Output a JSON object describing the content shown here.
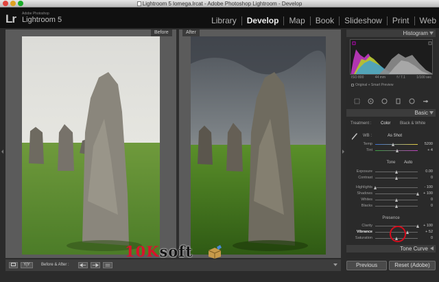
{
  "window": {
    "title": "Lightroom 5 lomega.lrcat - Adobe Photoshop Lightroom - Develop"
  },
  "identity": {
    "mark": "Lr",
    "adobe": "Adobe Photoshop",
    "product": "Lightroom 5"
  },
  "modules": [
    {
      "label": "Library",
      "active": false
    },
    {
      "label": "Develop",
      "active": true
    },
    {
      "label": "Map",
      "active": false
    },
    {
      "label": "Book",
      "active": false
    },
    {
      "label": "Slideshow",
      "active": false
    },
    {
      "label": "Print",
      "active": false
    },
    {
      "label": "Web",
      "active": false
    }
  ],
  "view": {
    "before_label": "Before",
    "after_label": "After"
  },
  "histogram": {
    "title": "Histogram",
    "iso": "ISO 800",
    "focal": "44 mm",
    "aperture": "f / 7.1",
    "shutter": "1/100 sec",
    "preview": "Original + Smart Preview"
  },
  "basic": {
    "title": "Basic",
    "treatment_label": "Treatment :",
    "treatment_color": "Color",
    "treatment_bw": "Black & White",
    "wb_label": "WB :",
    "wb_value": "As Shot",
    "temp": {
      "label": "Temp",
      "value": "5200",
      "pos": 0.43
    },
    "tint": {
      "label": "Tint",
      "value": "+ 4",
      "pos": 0.52
    },
    "tone_label": "Tone",
    "auto_label": "Auto",
    "exposure": {
      "label": "Exposure",
      "value": "0.00",
      "pos": 0.5
    },
    "contrast": {
      "label": "Contrast",
      "value": "0",
      "pos": 0.5
    },
    "highlights": {
      "label": "Highlights",
      "value": "- 100",
      "pos": 0.0
    },
    "shadows": {
      "label": "Shadows",
      "value": "+ 100",
      "pos": 1.0
    },
    "whites": {
      "label": "Whites",
      "value": "0",
      "pos": 0.5
    },
    "blacks": {
      "label": "Blacks",
      "value": "0",
      "pos": 0.5
    },
    "presence_label": "Presence",
    "clarity": {
      "label": "Clarity",
      "value": "+ 100",
      "pos": 1.0
    },
    "vibrance": {
      "label": "Vibrance",
      "value": "+ 52",
      "pos": 0.76
    },
    "saturation": {
      "label": "Saturation",
      "value": "0",
      "pos": 0.5
    }
  },
  "tone_curve": {
    "title": "Tone Curve"
  },
  "toolbar": {
    "before_after_label": "Before & After :",
    "view_btn_a": "",
    "view_btn_b": "Y|Y"
  },
  "buttons": {
    "previous": "Previous",
    "reset": "Reset (Adobe)"
  },
  "watermark": {
    "part_a": "10K",
    "part_b": "soft"
  }
}
